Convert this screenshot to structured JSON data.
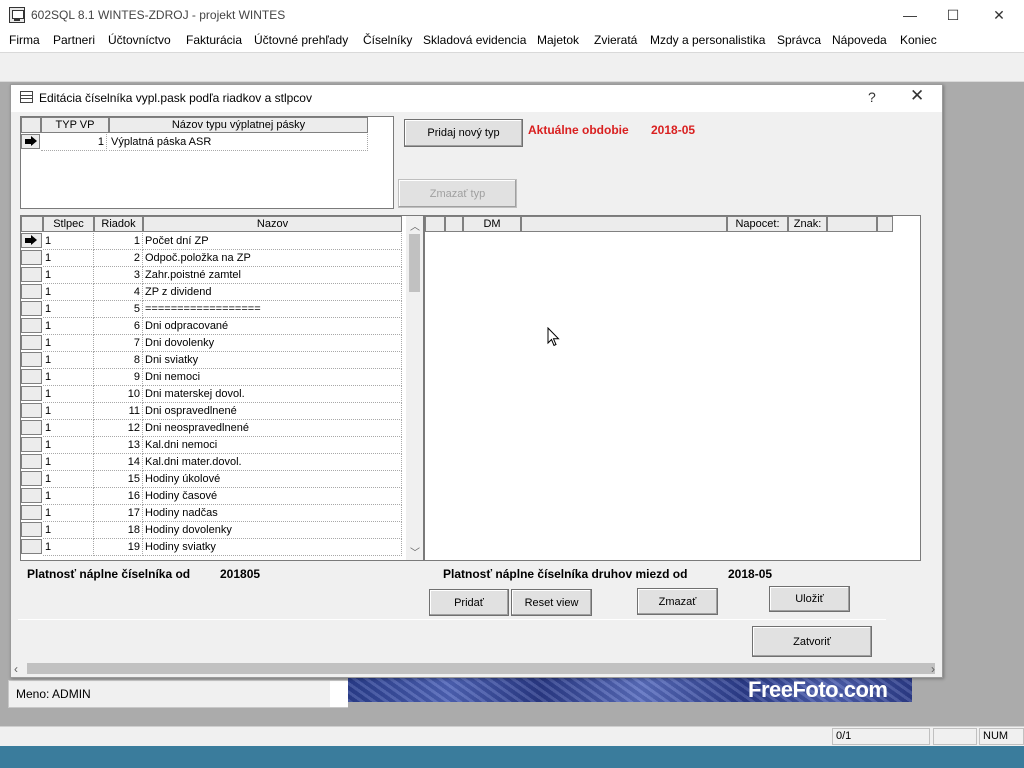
{
  "app": {
    "title": "602SQL 8.1 WINTES-ZDROJ - projekt WINTES",
    "controls": {
      "minimize": "—",
      "maximize": "☐",
      "close": "✕"
    }
  },
  "menu": [
    "Firma",
    "Partneri",
    "Účtovníctvo",
    "Fakturácia",
    "Účtovné prehľady",
    "Číselníky",
    "Skladová evidencia",
    "Majetok",
    "Zvieratá",
    "Mzdy a personalistika",
    "Správca",
    "Nápoveda",
    "Koniec"
  ],
  "dialog": {
    "title": "Editácia číselníka vypl.pask podľa riadkov a stlpcov",
    "help": "?",
    "close": "✕",
    "types_grid": {
      "headers": [
        "TYP VP",
        "Názov typu výplatnej pásky"
      ],
      "rows": [
        {
          "typ": "1",
          "nazov": "Výplatná páska ASR"
        }
      ]
    },
    "add_type_button": "Pridaj nový typ",
    "delete_type_button": "Zmazať typ",
    "period_label": "Aktuálne obdobie",
    "period_value": "2018-05",
    "rows_grid": {
      "headers": [
        "Stlpec",
        "Riadok",
        "Nazov"
      ],
      "rows": [
        {
          "stlpec": "1",
          "riadok": "1",
          "nazov": "Počet dní ZP"
        },
        {
          "stlpec": "1",
          "riadok": "2",
          "nazov": "Odpoč.položka na ZP"
        },
        {
          "stlpec": "1",
          "riadok": "3",
          "nazov": "Zahr.poistné zamtel"
        },
        {
          "stlpec": "1",
          "riadok": "4",
          "nazov": "ZP z dividend"
        },
        {
          "stlpec": "1",
          "riadok": "5",
          "nazov": "=================="
        },
        {
          "stlpec": "1",
          "riadok": "6",
          "nazov": "Dni odpracované"
        },
        {
          "stlpec": "1",
          "riadok": "7",
          "nazov": "Dni dovolenky"
        },
        {
          "stlpec": "1",
          "riadok": "8",
          "nazov": "Dni sviatky"
        },
        {
          "stlpec": "1",
          "riadok": "9",
          "nazov": "Dni nemoci"
        },
        {
          "stlpec": "1",
          "riadok": "10",
          "nazov": "Dni materskej dovol."
        },
        {
          "stlpec": "1",
          "riadok": "11",
          "nazov": "Dni ospravedlnené"
        },
        {
          "stlpec": "1",
          "riadok": "12",
          "nazov": "Dni neospravedlnené"
        },
        {
          "stlpec": "1",
          "riadok": "13",
          "nazov": "Kal.dni nemoci"
        },
        {
          "stlpec": "1",
          "riadok": "14",
          "nazov": "Kal.dni mater.dovol."
        },
        {
          "stlpec": "1",
          "riadok": "15",
          "nazov": "Hodiny úkolové"
        },
        {
          "stlpec": "1",
          "riadok": "16",
          "nazov": "Hodiny časové"
        },
        {
          "stlpec": "1",
          "riadok": "17",
          "nazov": "Hodiny nadčas"
        },
        {
          "stlpec": "1",
          "riadok": "18",
          "nazov": "Hodiny dovolenky"
        },
        {
          "stlpec": "1",
          "riadok": "19",
          "nazov": "Hodiny sviatky"
        }
      ]
    },
    "items_grid": {
      "headers": [
        "",
        "DM",
        "",
        "Napocet:",
        "Znak:",
        ""
      ]
    },
    "validity_label": "Platnosť náplne číselníka od",
    "validity_value": "201805",
    "validity_types_label": "Platnosť náplne číselníka druhov miezd od",
    "validity_types_value": "2018-05",
    "buttons": {
      "add": "Pridať",
      "reset": "Reset view",
      "delete": "Zmazať",
      "save": "Uložiť",
      "close": "Zatvoriť"
    }
  },
  "login": {
    "label": "Meno: ADMIN"
  },
  "banner": {
    "text": "FreeFoto.com"
  },
  "status": {
    "counter": "0/1",
    "num": "NUM"
  }
}
